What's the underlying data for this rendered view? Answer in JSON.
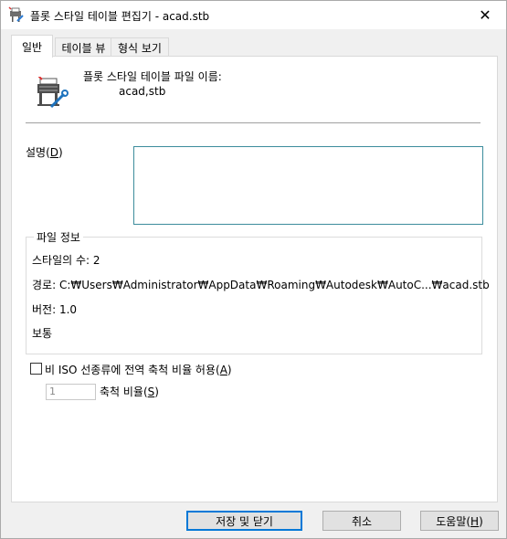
{
  "window": {
    "title": "플롯 스타일 테이블 편집기 - acad.stb",
    "close_glyph": "✕"
  },
  "tabs": [
    {
      "label": "일반",
      "active": true
    },
    {
      "label": "테이블 뷰",
      "active": false
    },
    {
      "label": "형식 보기",
      "active": false
    }
  ],
  "general": {
    "file_name_label": "플롯 스타일 테이블 파일 이름:",
    "file_name_value": "acad,stb",
    "description_label_pre": "설명(",
    "description_label_key": "D",
    "description_label_post": ")",
    "description_value": "",
    "file_info": {
      "legend": "파일 정보",
      "style_count": "스타일의 수: 2",
      "path": "경로: C:₩Users₩Administrator₩AppData₩Roaming₩Autodesk₩AutoC...₩acad.stb",
      "version": "버전: 1.0",
      "normal": "보통"
    },
    "non_iso_checkbox": {
      "label_pre": "비 ISO 선종류에 전역 축척 비율 허용(",
      "label_key": "A",
      "label_post": ")",
      "checked": false
    },
    "scale_factor": {
      "value": "1",
      "label_pre": "축척 비율(",
      "label_key": "S",
      "label_post": ")"
    }
  },
  "buttons": {
    "save_close": "저장 및 닫기",
    "cancel": "취소",
    "help_pre": "도움말(",
    "help_key": "H",
    "help_post": ")"
  },
  "icons": {
    "title": "plotter-icon",
    "file": "plot-style-table-icon"
  }
}
